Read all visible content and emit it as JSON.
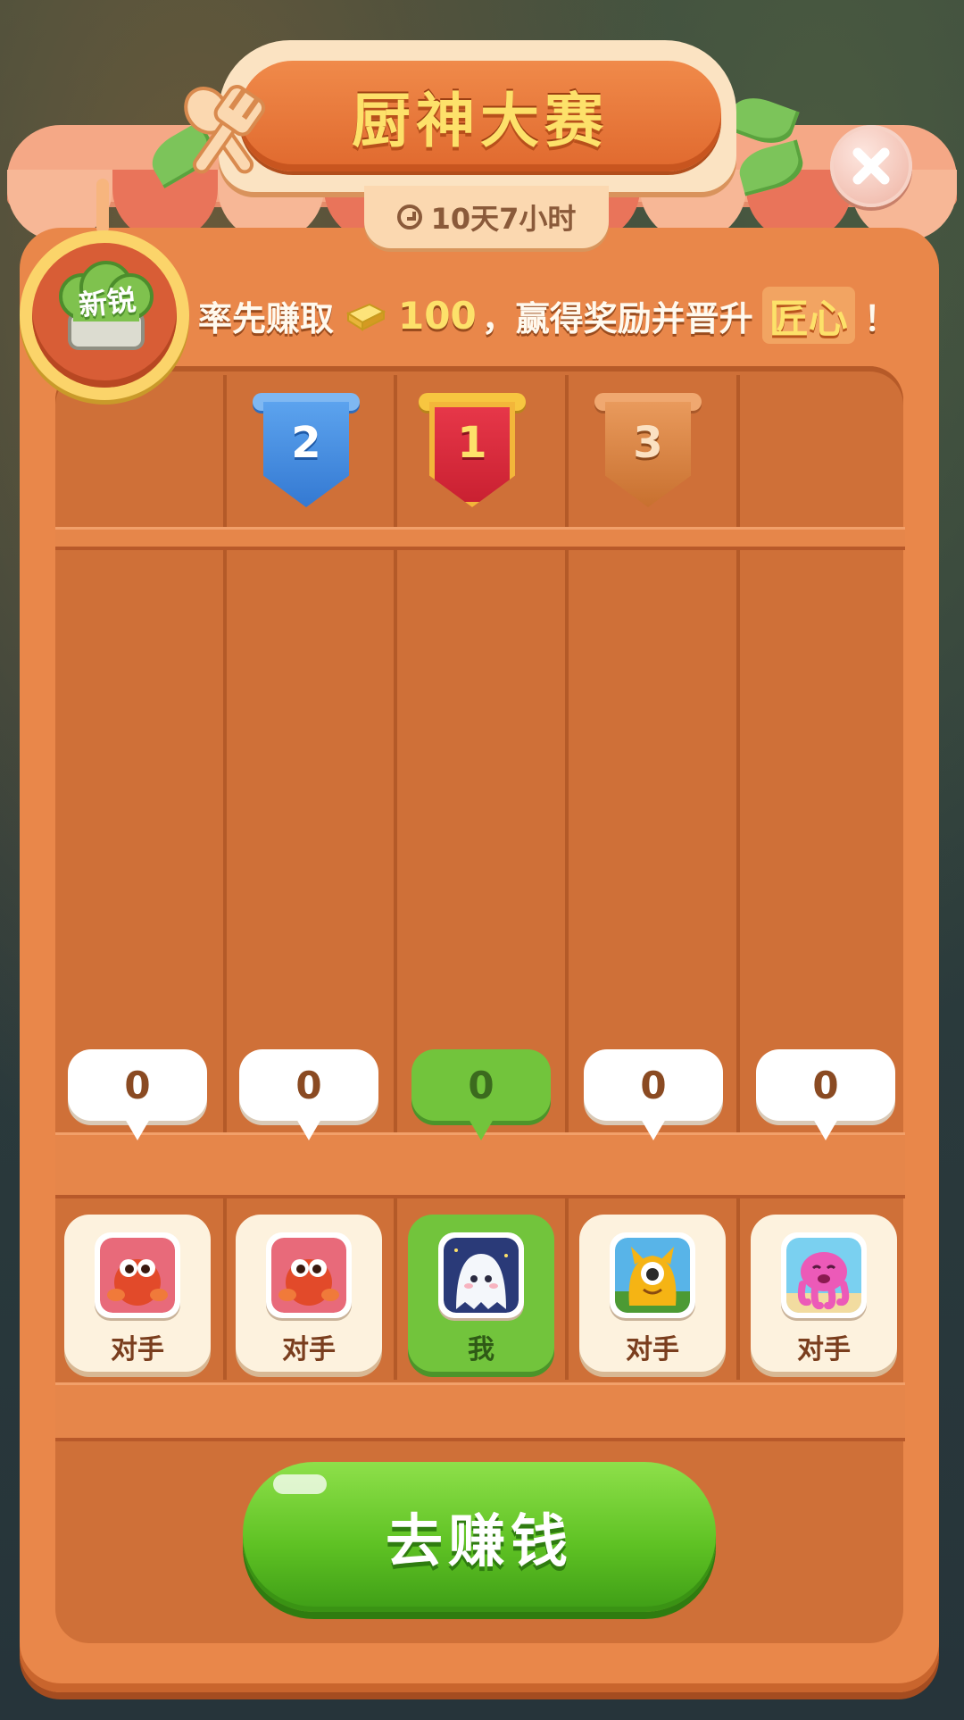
{
  "title": "厨神大赛",
  "timer": "10天7小时",
  "badge": {
    "label": "新锐"
  },
  "headline": {
    "prefix": "率先赚取",
    "amount": "100",
    "middle": "，赢得奖励并晋升",
    "rank_name": "匠心",
    "suffix": "！"
  },
  "ranks": [
    {
      "position": "2",
      "color": "#4a8fe0"
    },
    {
      "position": "1",
      "color": "#d8283a"
    },
    {
      "position": "3",
      "color": "#d9823e"
    }
  ],
  "players": [
    {
      "score": "0",
      "label": "对手",
      "is_me": false,
      "avatar_icon": "hermit-crab-icon"
    },
    {
      "score": "0",
      "label": "对手",
      "is_me": false,
      "avatar_icon": "hermit-crab-icon"
    },
    {
      "score": "0",
      "label": "我",
      "is_me": true,
      "avatar_icon": "ghost-icon"
    },
    {
      "score": "0",
      "label": "对手",
      "is_me": false,
      "avatar_icon": "yellow-monster-icon"
    },
    {
      "score": "0",
      "label": "对手",
      "is_me": false,
      "avatar_icon": "pink-octopus-icon"
    }
  ],
  "go_button": {
    "label": "去赚钱"
  },
  "colors": {
    "accent_green": "#5fc224",
    "panel": "#e9874a",
    "title_text": "#fde16a"
  }
}
